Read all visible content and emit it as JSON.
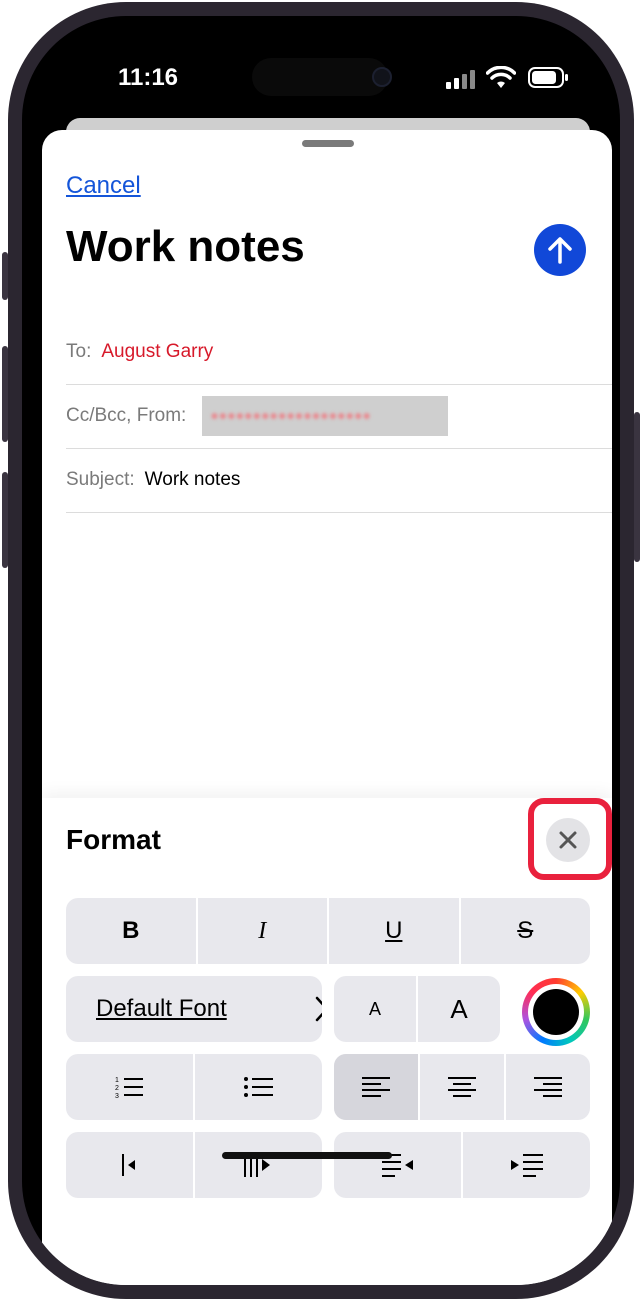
{
  "status": {
    "time": "11:16"
  },
  "compose": {
    "cancel_label": "Cancel",
    "title": "Work notes",
    "to_label": "To:",
    "to_value": "August Garry",
    "ccbcc_label": "Cc/Bcc, From:",
    "from_value_redacted": "[email redacted]",
    "subject_label": "Subject:",
    "subject_value": "Work notes"
  },
  "format": {
    "title": "Format",
    "style_buttons": [
      "B",
      "I",
      "U",
      "S"
    ],
    "font_label": "Default Font",
    "size_small": "A",
    "size_large": "A",
    "text_color": "#000000"
  },
  "colors": {
    "accent": "#1148d8",
    "recipient": "#d7192a",
    "highlight": "#e9213d"
  }
}
